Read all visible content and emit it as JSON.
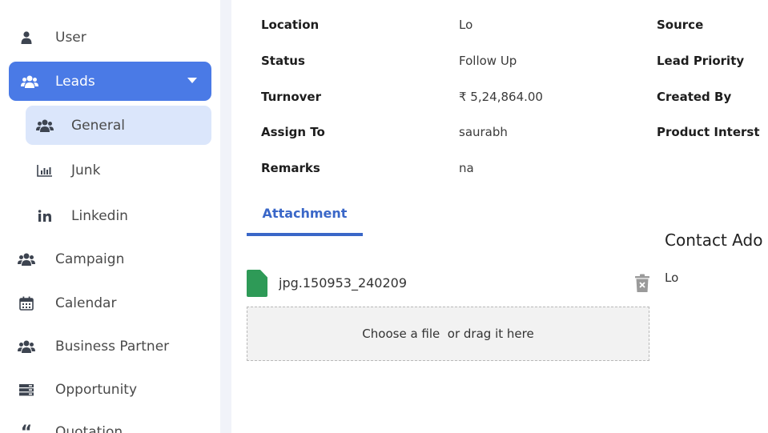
{
  "sidebar": {
    "items": [
      {
        "label": "User",
        "icon": "user-icon"
      },
      {
        "label": "Leads",
        "icon": "users-icon",
        "active": true
      },
      {
        "label": "General",
        "icon": "users-icon"
      },
      {
        "label": "Junk",
        "icon": "bar-chart-icon"
      },
      {
        "label": "Linkedin",
        "icon": "linkedin-icon"
      },
      {
        "label": "Campaign",
        "icon": "users-icon"
      },
      {
        "label": "Calendar",
        "icon": "calendar-icon"
      },
      {
        "label": "Business Partner",
        "icon": "users-icon"
      },
      {
        "label": "Opportunity",
        "icon": "server-icon"
      },
      {
        "label": "Quotation",
        "icon": "quote-icon"
      }
    ],
    "active_color": "#4a7ae6",
    "sub_active_color": "#dbe6fb"
  },
  "details": {
    "location_label": "Location",
    "location_value": "Lo",
    "status_label": "Status",
    "status_value": "Follow Up",
    "turnover_label": "Turnover",
    "turnover_value": "₹ 5,24,864.00",
    "assign_label": "Assign To",
    "assign_value": "saurabh",
    "remarks_label": "Remarks",
    "remarks_value": "na",
    "source_label": "Source",
    "priority_label": "Lead Priority",
    "created_label": "Created By",
    "product_label": "Product Interst"
  },
  "attachment": {
    "tab_label": "Attachment",
    "file_name": "240209_150953.jpg",
    "dropzone_text": "Choose a file  or drag it here",
    "file_color": "#2e9a57"
  },
  "contact": {
    "title": "Contact Ado",
    "value": "Lo"
  }
}
